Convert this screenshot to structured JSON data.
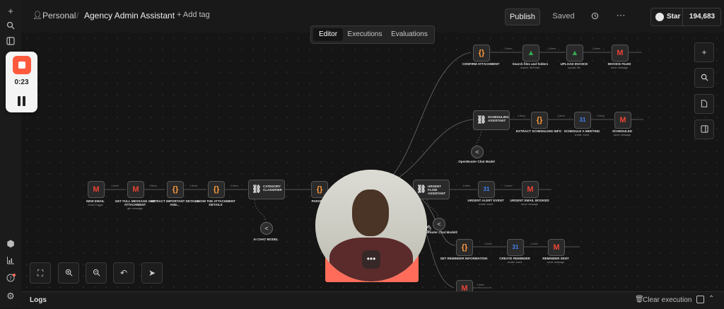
{
  "header": {
    "project": "Personal",
    "workflow_title": "Agency Admin Assistant",
    "add_tag": "+ Add tag",
    "publish_label": "Publish",
    "saved_label": "Saved",
    "github_star_label": "Star",
    "github_star_count": "194,683"
  },
  "tabs": [
    {
      "label": "Editor",
      "active": true
    },
    {
      "label": "Executions",
      "active": false
    },
    {
      "label": "Evaluations",
      "active": false
    }
  ],
  "recording": {
    "timer": "0:23"
  },
  "nodes": [
    {
      "id": "new-email",
      "label": "NEW EMAIL",
      "sub": "Gmail Trigger",
      "icon": "gmail-icon",
      "glyph": "M"
    },
    {
      "id": "get-full-message",
      "label": "GET FULL MESSAGE AND ATTACHMENT",
      "sub": "get: message",
      "icon": "gmail-icon",
      "glyph": "M"
    },
    {
      "id": "extract-important",
      "label": "EXTRACT IMPORTANT DETAILS AND...",
      "sub": "",
      "icon": "code-icon",
      "glyph": "{}"
    },
    {
      "id": "show-attachment",
      "label": "SHOW THE ATTACHMENT DETAILS",
      "sub": "",
      "icon": "code-icon",
      "glyph": "{}"
    },
    {
      "id": "category-classifier",
      "label": "CATEGORY CLASSIFIER",
      "sub": "",
      "icon": "link-icon",
      "glyph": "⛓"
    },
    {
      "id": "parse-ai",
      "label": "PARSE AI",
      "sub": "",
      "icon": "code-icon",
      "glyph": "{}"
    },
    {
      "id": "confirm-attachment",
      "label": "CONFIRM ATTACHMENT",
      "sub": "",
      "icon": "code-icon",
      "glyph": "{}"
    },
    {
      "id": "search-files",
      "label": "Search files and folders",
      "sub": "search: fileFolder",
      "icon": "drive-icon",
      "glyph": "▲"
    },
    {
      "id": "upload-invoice",
      "label": "UPLOAD INVOICE",
      "sub": "upload: file",
      "icon": "drive-icon",
      "glyph": "▲"
    },
    {
      "id": "invoice-filed",
      "label": "INVOICE FILED",
      "sub": "send: message",
      "icon": "gmail-icon",
      "glyph": "M"
    },
    {
      "id": "scheduling-assistant",
      "label": "SCHEDULING ASSISTANT",
      "sub": "",
      "icon": "link-icon",
      "glyph": "⛓"
    },
    {
      "id": "extract-scheduling",
      "label": "EXTRACT SCHEDULING INFO",
      "sub": "",
      "icon": "code-icon",
      "glyph": "{}"
    },
    {
      "id": "schedule-meeting",
      "label": "SCHEDULE A MEETING",
      "sub": "create: event",
      "icon": "calendar-icon",
      "glyph": "31"
    },
    {
      "id": "scheduled",
      "label": "SCHEDULED",
      "sub": "send: message",
      "icon": "gmail-icon",
      "glyph": "M"
    },
    {
      "id": "urgent-flow",
      "label": "URGENT FLOW ASSISTANT",
      "sub": "",
      "icon": "link-icon",
      "glyph": "⛓"
    },
    {
      "id": "urgent-alert",
      "label": "URGENT ALERT EVENT",
      "sub": "create: event",
      "icon": "calendar-icon",
      "glyph": "31"
    },
    {
      "id": "urgent-email",
      "label": "URGENT EMAIL BOOKED",
      "sub": "send: message",
      "icon": "gmail-icon",
      "glyph": "M"
    },
    {
      "id": "set-reminder",
      "label": "SET REMINDER INFORMATION",
      "sub": "",
      "icon": "code-icon",
      "glyph": "{}"
    },
    {
      "id": "create-reminder",
      "label": "CREATE REMINDER",
      "sub": "create: event",
      "icon": "calendar-icon",
      "glyph": "31"
    },
    {
      "id": "reminder-sent",
      "label": "REMINDER SENT",
      "sub": "send: message",
      "icon": "gmail-icon",
      "glyph": "M"
    },
    {
      "id": "last-gmail",
      "label": "",
      "sub": "",
      "icon": "gmail-icon",
      "glyph": "M"
    }
  ],
  "models": [
    {
      "id": "ai-chat-model",
      "label": "AI Chat Model"
    },
    {
      "id": "openrouter-chat-model",
      "label": "OpenRouter Chat Model"
    },
    {
      "id": "openrouter-chat-model2",
      "label": "OpenRouter Chat Model2"
    }
  ],
  "edge_labels": {
    "item": "1 item"
  },
  "logs": {
    "title": "Logs",
    "clear_label": "Clear execution"
  },
  "colors": {
    "accent": "#ff6d5a",
    "bg": "#141414",
    "gmail": "#ea4335",
    "drive": "#34a853",
    "calendar": "#4285f4",
    "code": "#ff9b3d"
  }
}
